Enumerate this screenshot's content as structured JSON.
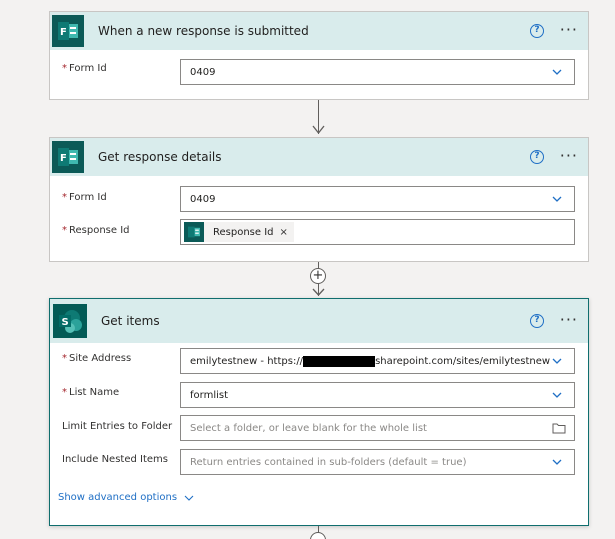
{
  "cards": {
    "trigger": {
      "title": "When a new response is submitted",
      "form_id_label": "Form Id",
      "form_id_value": "0409"
    },
    "details": {
      "title": "Get response details",
      "form_id_label": "Form Id",
      "form_id_value": "0409",
      "response_id_label": "Response Id",
      "response_token": "Response Id"
    },
    "get_items": {
      "title": "Get items",
      "site_address_label": "Site Address",
      "site_address_prefix": "emilytestnew - https://",
      "site_address_suffix": "sharepoint.com/sites/emilytestnew",
      "list_name_label": "List Name",
      "list_name_value": "formlist",
      "limit_folder_label": "Limit Entries to Folder",
      "limit_folder_placeholder": "Select a folder, or leave blank for the whole list",
      "nested_items_label": "Include Nested Items",
      "nested_items_placeholder": "Return entries contained in sub-folders (default = true)",
      "advanced_options": "Show advanced options"
    }
  },
  "common": {
    "required_mark": "*",
    "help_glyph": "?",
    "more_glyph": "···",
    "remove_glyph": "×",
    "plus_glyph": "+"
  },
  "colors": {
    "header_bg": "#d9ecec",
    "forms_icon_bg": "#0b5a57",
    "sharepoint_icon_bg": "#035b56",
    "link": "#1f6fc5",
    "required": "#a4262c"
  },
  "icons": [
    "forms-icon",
    "sharepoint-icon",
    "help-icon",
    "more-icon",
    "chevron-down-icon",
    "folder-icon",
    "plus-icon",
    "arrow-down-icon"
  ]
}
